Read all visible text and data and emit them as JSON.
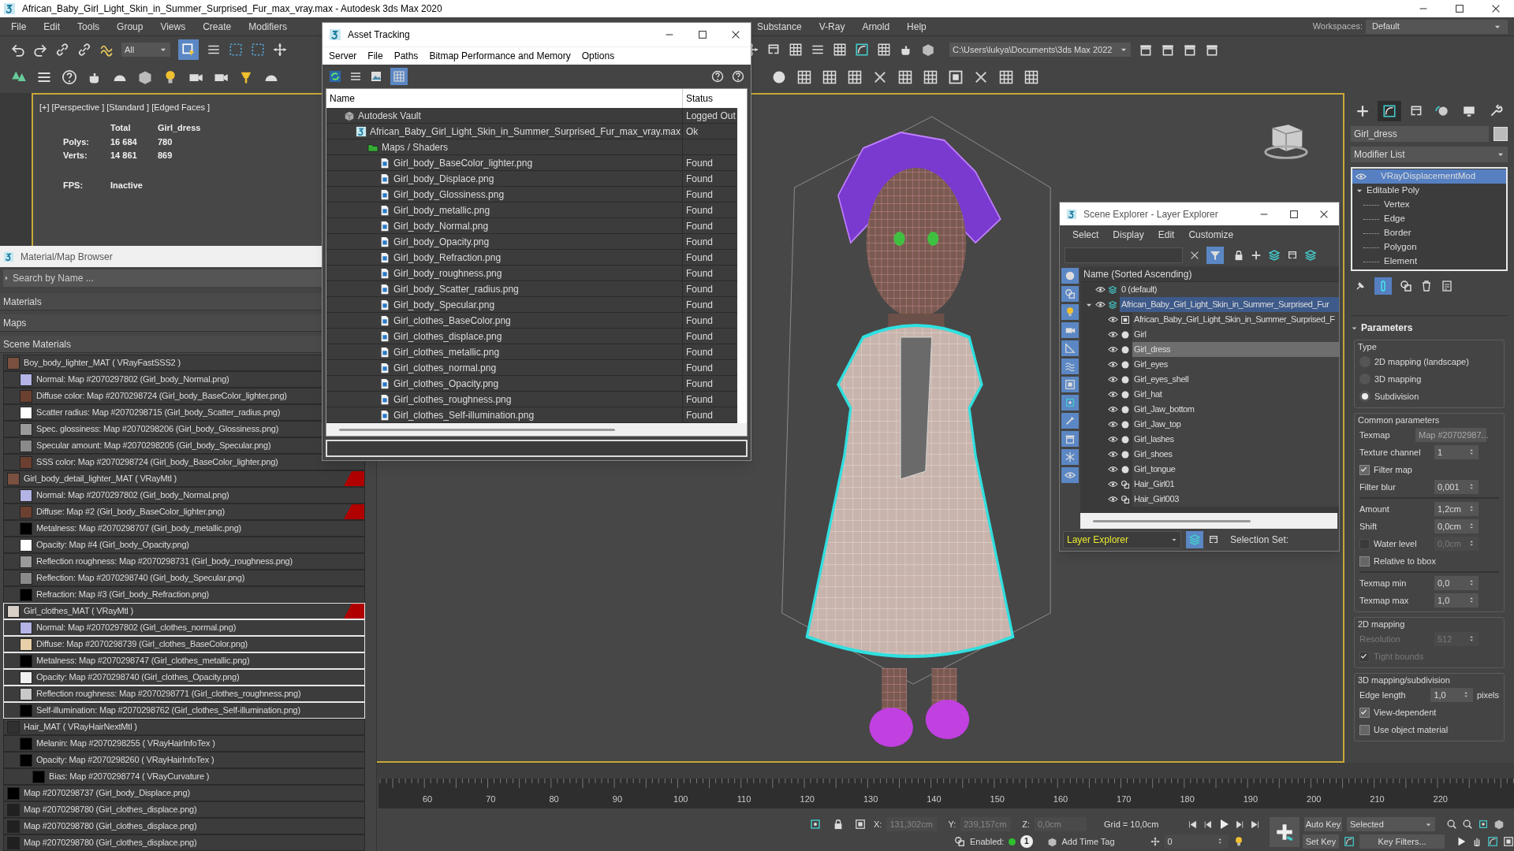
{
  "window": {
    "title": "African_Baby_Girl_Light_Skin_in_Summer_Surprised_Fur_max_vray.max - Autodesk 3ds Max 2020"
  },
  "menu_bar": {
    "left_items": [
      "File",
      "Edit",
      "Tools",
      "Group",
      "Views",
      "Create",
      "Modifiers"
    ],
    "right_items": [
      "Substance",
      "V-Ray",
      "Arnold",
      "Help"
    ],
    "workspaces_label": "Workspaces:",
    "workspace": "Default"
  },
  "toolbar": {
    "selection_filter": "All",
    "project_path": "C:\\Users\\lukya\\Documents\\3ds Max 2022"
  },
  "viewport": {
    "label": "[+] [Perspective ] [Standard ] [Edged Faces ]",
    "stats_header": [
      "Total",
      "Girl_dress"
    ],
    "stats": [
      {
        "label": "Polys:",
        "total": "16 684",
        "selected": "780"
      },
      {
        "label": "Verts:",
        "total": "14 861",
        "selected": "869"
      }
    ],
    "fps_label": "FPS:",
    "fps": "Inactive"
  },
  "material_browser": {
    "title": "Material/Map Browser",
    "search_placeholder": "Search by Name ...",
    "sections": [
      "Materials",
      "Maps",
      "Scene Materials"
    ],
    "items": [
      {
        "label": "Boy_body_lighter_MAT ( VRayFastSSS2 )",
        "color": "#7a5040",
        "flagged": false,
        "selected": false,
        "children": [
          {
            "label": "Normal: Map #2070297802 (Girl_body_Normal.png)",
            "color": "#b4b4e6",
            "flagged": false
          },
          {
            "label": "Diffuse color: Map #2070298724 (Girl_body_BaseColor_lighter.png)",
            "color": "#6b4030",
            "flagged": false
          },
          {
            "label": "Scatter radius: Map #2070298715 (Girl_body_Scatter_radius.png)",
            "color": "#ffffff",
            "flagged": false
          },
          {
            "label": "Spec. glossiness: Map #2070298206 (Girl_body_Glossiness.png)",
            "color": "#9a9a9a",
            "flagged": false
          },
          {
            "label": "Specular amount: Map #2070298205 (Girl_body_Specular.png)",
            "color": "#8a8a8a",
            "flagged": false
          },
          {
            "label": "SSS color: Map #2070298724 (Girl_body_BaseColor_lighter.png)",
            "color": "#6b4030",
            "flagged": false
          }
        ]
      },
      {
        "label": "Girl_body_detail_lighter_MAT ( VRayMtl )",
        "color": "#7a5040",
        "flagged": true,
        "selected": false,
        "children": [
          {
            "label": "Normal: Map #2070297802 (Girl_body_Normal.png)",
            "color": "#b4b4e6",
            "flagged": false
          },
          {
            "label": "Diffuse: Map #2 (Girl_body_BaseColor_lighter.png)",
            "color": "#6b4030",
            "flagged": true
          },
          {
            "label": "Metalness: Map #2070298707 (Girl_body_metallic.png)",
            "color": "#000000",
            "flagged": false
          },
          {
            "label": "Opacity: Map #4 (Girl_body_Opacity.png)",
            "color": "#ffffff",
            "flagged": false
          },
          {
            "label": "Reflection roughness: Map #2070298731 (Girl_body_roughness.png)",
            "color": "#9a9a9a",
            "flagged": false
          },
          {
            "label": "Reflection: Map #2070298740 (Girl_body_Specular.png)",
            "color": "#8a8a8a",
            "flagged": false
          },
          {
            "label": "Refraction: Map #3 (Girl_body_Refraction.png)",
            "color": "#000000",
            "flagged": false
          }
        ]
      },
      {
        "label": "Girl_clothes_MAT ( VRayMtl )",
        "color": "#d8d0c8",
        "flagged": true,
        "selected": true,
        "children": [
          {
            "label": "Normal: Map #2070297802 (Girl_clothes_normal.png)",
            "color": "#b4b4e6",
            "flagged": false
          },
          {
            "label": "Diffuse: Map #2070298739 (Girl_clothes_BaseColor.png)",
            "color": "#e8d0a8",
            "flagged": false
          },
          {
            "label": "Metalness: Map #2070298747 (Girl_clothes_metallic.png)",
            "color": "#000000",
            "flagged": false
          },
          {
            "label": "Opacity: Map #2070298740 (Girl_clothes_Opacity.png)",
            "color": "#f0f0f0",
            "flagged": false
          },
          {
            "label": "Reflection roughness: Map #2070298771 (Girl_clothes_roughness.png)",
            "color": "#c8c8c8",
            "flagged": false
          },
          {
            "label": "Self-illumination: Map #2070298762 (Girl_clothes_Self-illumination.png)",
            "color": "#000000",
            "flagged": false
          }
        ]
      },
      {
        "label": "Hair_MAT ( VRayHairNextMtl )",
        "color": "#303030",
        "flagged": false,
        "selected": false,
        "children": [
          {
            "label": "Melanin: Map #2070298255 ( VRayHairInfoTex )",
            "color": "#000000",
            "flagged": false
          },
          {
            "label": "Opacity: Map #2070298260 ( VRayHairInfoTex )",
            "color": "#000000",
            "flagged": false,
            "children": [
              {
                "label": "Bias: Map #2070298774 ( VRayCurvature )",
                "color": "#000000",
                "flagged": false
              }
            ]
          }
        ]
      },
      {
        "label": "Map #2070298737 (Girl_body_Displace.png)",
        "color": "#000000",
        "flagged": false,
        "selected": false
      },
      {
        "label": "Map #2070298780 (Girl_clothes_displace.png)",
        "color": "#202020",
        "flagged": false,
        "selected": false
      },
      {
        "label": "Map #2070298780 (Girl_clothes_displace.png)",
        "color": "#202020",
        "flagged": false,
        "selected": false
      },
      {
        "label": "Map #2070298780 (Girl_clothes_displace.png)",
        "color": "#202020",
        "flagged": false,
        "selected": false
      }
    ]
  },
  "asset_tracking": {
    "title": "Asset Tracking",
    "menu": [
      "Server",
      "File",
      "Paths",
      "Bitmap Performance and Memory",
      "Options"
    ],
    "columns": [
      "Name",
      "Status"
    ],
    "rows": [
      {
        "kind": "vault",
        "name": "Autodesk Vault",
        "status": "Logged Out",
        "children": [
          {
            "kind": "scene",
            "name": "African_Baby_Girl_Light_Skin_in_Summer_Surprised_Fur_max_vray.max",
            "status": "Ok",
            "children": [
              {
                "kind": "folder",
                "name": "Maps / Shaders",
                "children": [
                  {
                    "kind": "file",
                    "name": "Girl_body_BaseColor_lighter.png",
                    "status": "Found"
                  },
                  {
                    "kind": "file",
                    "name": "Girl_body_Displace.png",
                    "status": "Found"
                  },
                  {
                    "kind": "file",
                    "name": "Girl_body_Glossiness.png",
                    "status": "Found"
                  },
                  {
                    "kind": "file",
                    "name": "Girl_body_metallic.png",
                    "status": "Found"
                  },
                  {
                    "kind": "file",
                    "name": "Girl_body_Normal.png",
                    "status": "Found"
                  },
                  {
                    "kind": "file",
                    "name": "Girl_body_Opacity.png",
                    "status": "Found"
                  },
                  {
                    "kind": "file",
                    "name": "Girl_body_Refraction.png",
                    "status": "Found"
                  },
                  {
                    "kind": "file",
                    "name": "Girl_body_roughness.png",
                    "status": "Found"
                  },
                  {
                    "kind": "file",
                    "name": "Girl_body_Scatter_radius.png",
                    "status": "Found"
                  },
                  {
                    "kind": "file",
                    "name": "Girl_body_Specular.png",
                    "status": "Found"
                  },
                  {
                    "kind": "file",
                    "name": "Girl_clothes_BaseColor.png",
                    "status": "Found"
                  },
                  {
                    "kind": "file",
                    "name": "Girl_clothes_displace.png",
                    "status": "Found"
                  },
                  {
                    "kind": "file",
                    "name": "Girl_clothes_metallic.png",
                    "status": "Found"
                  },
                  {
                    "kind": "file",
                    "name": "Girl_clothes_normal.png",
                    "status": "Found"
                  },
                  {
                    "kind": "file",
                    "name": "Girl_clothes_Opacity.png",
                    "status": "Found"
                  },
                  {
                    "kind": "file",
                    "name": "Girl_clothes_roughness.png",
                    "status": "Found"
                  },
                  {
                    "kind": "file",
                    "name": "Girl_clothes_Self-illumination.png",
                    "status": "Found"
                  }
                ]
              }
            ]
          }
        ]
      }
    ]
  },
  "scene_explorer": {
    "title": "Scene Explorer - Layer Explorer",
    "menu": [
      "Select",
      "Display",
      "Edit",
      "Customize"
    ],
    "column": "Name (Sorted Ascending)",
    "tree": [
      {
        "kind": "layer",
        "name": "0 (default)",
        "active": false
      },
      {
        "kind": "layer",
        "name": "African_Baby_Girl_Light_Skin_in_Summer_Surprised_Fur",
        "active": true,
        "expanded": true,
        "children": [
          {
            "kind": "container",
            "name": "African_Baby_Girl_Light_Skin_in_Summer_Surprised_F",
            "selected": false
          },
          {
            "kind": "object",
            "name": "Girl",
            "selected": false
          },
          {
            "kind": "object",
            "name": "Girl_dress",
            "selected": true
          },
          {
            "kind": "object",
            "name": "Girl_eyes",
            "selected": false
          },
          {
            "kind": "object",
            "name": "Girl_eyes_shell",
            "selected": false
          },
          {
            "kind": "object",
            "name": "Girl_hat",
            "selected": false
          },
          {
            "kind": "object",
            "name": "Girl_Jaw_bottom",
            "selected": false
          },
          {
            "kind": "object",
            "name": "Girl_Jaw_top",
            "selected": false
          },
          {
            "kind": "object",
            "name": "Girl_lashes",
            "selected": false
          },
          {
            "kind": "object",
            "name": "Girl_shoes",
            "selected": false
          },
          {
            "kind": "object",
            "name": "Girl_tongue",
            "selected": false
          },
          {
            "kind": "hair",
            "name": "Hair_Girl01",
            "selected": false
          },
          {
            "kind": "hair",
            "name": "Hair_Girl003",
            "selected": false
          }
        ]
      }
    ],
    "explorer_type": "Layer Explorer",
    "selection_set_label": "Selection Set:"
  },
  "command_panel": {
    "tabs": [
      {
        "selected": false
      },
      {
        "selected": true
      },
      {
        "selected": false
      },
      {
        "selected": false
      },
      {
        "selected": false
      },
      {
        "selected": false
      }
    ],
    "object_name": "Girl_dress",
    "modifier_list": "Modifier List",
    "stack": [
      {
        "label": "VRayDisplacementMod",
        "selected": true
      },
      {
        "label": "Editable Poly",
        "selected": false,
        "expanded": true,
        "children": [
          "Vertex",
          "Edge",
          "Border",
          "Polygon",
          "Element"
        ]
      }
    ],
    "rollout_title": "Parameters",
    "groups": [
      {
        "title": "Type",
        "rows": [
          {
            "kind": "radio",
            "label": "2D mapping (landscape)",
            "selected": false
          },
          {
            "kind": "radio",
            "label": "3D mapping",
            "selected": false
          },
          {
            "kind": "radio",
            "label": "Subdivision",
            "selected": true
          }
        ]
      },
      {
        "title": "Common parameters",
        "rows": [
          {
            "kind": "texmap",
            "label": "Texmap",
            "value": "Map #20702987..."
          },
          {
            "kind": "spinner",
            "label": "Texture channel",
            "value": "1",
            "disabled": false
          },
          {
            "kind": "checkbox",
            "label": "Filter map",
            "checked": true,
            "disabled": false
          },
          {
            "kind": "spinner",
            "label": "Filter blur",
            "value": "0,001",
            "disabled": false
          },
          {
            "kind": "divider"
          },
          {
            "kind": "spinner",
            "label": "Amount",
            "value": "1,2cm",
            "disabled": false
          },
          {
            "kind": "spinner",
            "label": "Shift",
            "value": "0,0cm",
            "disabled": false
          },
          {
            "kind": "checkbox_spinner",
            "label": "Water level",
            "checked": false,
            "value": "0,0cm",
            "disabled": true
          },
          {
            "kind": "checkbox",
            "label": "Relative to bbox",
            "checked": false,
            "disabled": false
          },
          {
            "kind": "divider"
          },
          {
            "kind": "spinner",
            "label": "Texmap min",
            "value": "0,0",
            "disabled": false
          },
          {
            "kind": "spinner",
            "label": "Texmap max",
            "value": "1,0",
            "disabled": false
          }
        ]
      },
      {
        "title": "2D mapping",
        "rows": [
          {
            "kind": "spinner",
            "label": "Resolution",
            "value": "512",
            "disabled": true
          },
          {
            "kind": "checkbox",
            "label": "Tight bounds",
            "checked": true,
            "disabled": true
          }
        ]
      },
      {
        "title": "3D mapping/subdivision",
        "rows": [
          {
            "kind": "spinner",
            "label": "Edge length",
            "value": "1,0",
            "unit": "pixels",
            "disabled": false
          },
          {
            "kind": "checkbox",
            "label": "View-dependent",
            "checked": true,
            "disabled": false
          },
          {
            "kind": "checkbox",
            "label": "Use object material",
            "checked": false,
            "disabled": false
          }
        ]
      }
    ]
  },
  "timeline": {
    "ticks": [
      "60",
      "70",
      "80",
      "90",
      "100",
      "110",
      "120",
      "130",
      "140",
      "150",
      "160",
      "170",
      "180",
      "190",
      "200",
      "210",
      "220"
    ]
  },
  "status_bar": {
    "x_label": "X:",
    "x": "131,302cm",
    "y_label": "Y:",
    "y": "239,157cm",
    "z_label": "Z:",
    "z": "0,0cm",
    "grid": "Grid = 10,0cm",
    "enabled_label": "Enabled:",
    "enabled": true,
    "badge": "1",
    "time_tag": "Add Time Tag",
    "frame": "0",
    "auto_key": "Auto Key",
    "set_key": "Set Key",
    "key_mode": "Selected",
    "key_filters": "Key Filters..."
  }
}
